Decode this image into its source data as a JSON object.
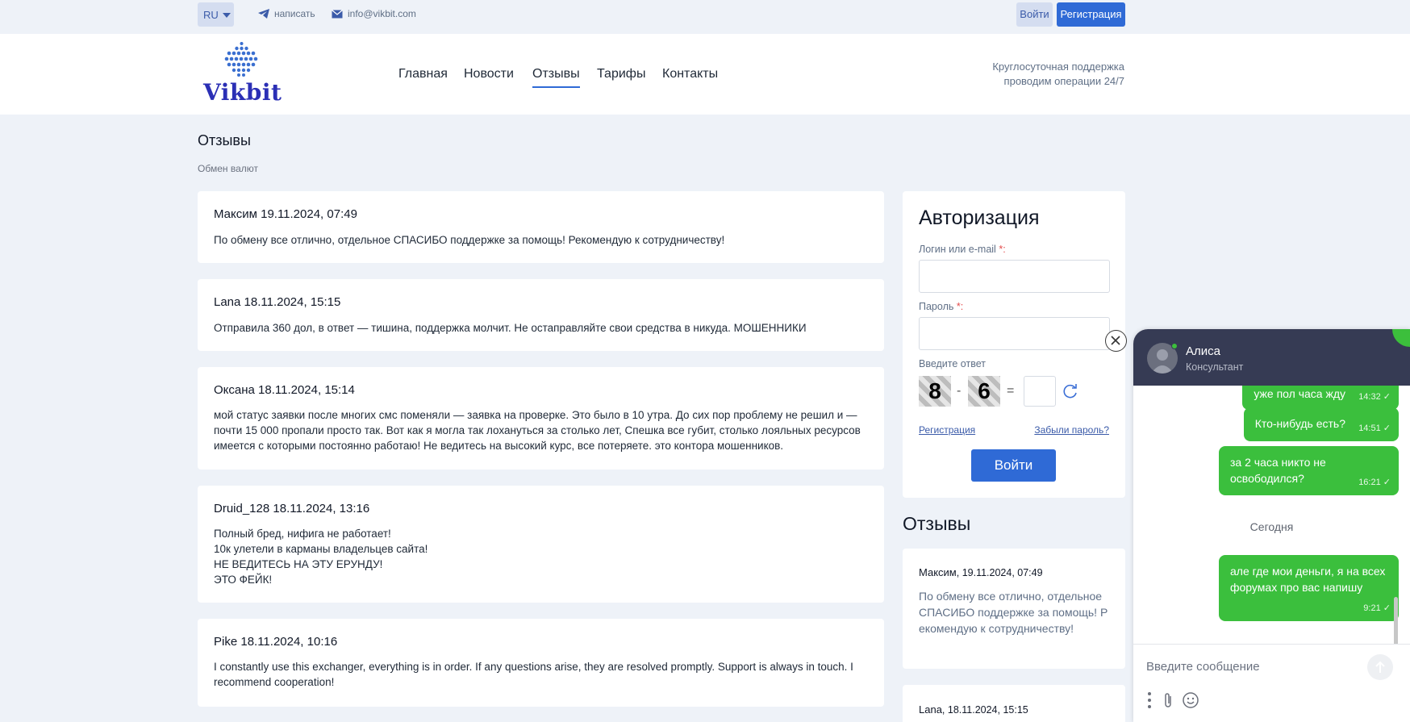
{
  "topbar": {
    "lang": "RU",
    "write_label": "написать",
    "email": "info@vikbit.com",
    "login_label": "Войти",
    "register_label": "Регистрация"
  },
  "header": {
    "logo_text": "Vikbit",
    "nav": [
      "Главная",
      "Новости",
      "Отзывы",
      "Тарифы",
      "Контакты"
    ],
    "active_nav": "Отзывы",
    "support_line1": "Круглосуточная поддержка",
    "support_line2": "проводим операции 24/7"
  },
  "page": {
    "title": "Отзывы",
    "breadcrumb": "Обмен валют"
  },
  "reviews": [
    {
      "header": "Максим 19.11.2024, 07:49",
      "text": "По обмену все отлично, отдельное СПАСИБО поддержке за помощь! Рекомендую к сотрудничеству!"
    },
    {
      "header": "Lana 18.11.2024, 15:15",
      "text": "Отправила 360 дол, в ответ — тишина, поддержка молчит. Не остаправляйте свои средства в никуда. МОШЕННИКИ"
    },
    {
      "header": "Оксана 18.11.2024, 15:14",
      "text": "мой статус заявки после многих смс поменяли — заявка на проверке. Это было в 10 утра. До сих пор проблему не решил и — почти 15 000 пропали просто так. Вот как я могла так лохануться за столько лет, Спешка все губит, столько лояльных ресурсов имеется с которыми постоянно работаю! Не ведитесь на высокий курс, все потеряете. это контора мошенников."
    },
    {
      "header": "Druid_128 18.11.2024, 13:16",
      "lines": [
        "Полный бред, нифига не работает!",
        "10к улетели в карманы владельцев сайта!",
        "НЕ ВЕДИТЕСЬ НА ЭТУ ЕРУНДУ!",
        "ЭТО ФЕЙК!"
      ]
    },
    {
      "header": "Pike 18.11.2024, 10:16",
      "text": "I constantly use this exchanger, everything is in order. If any questions arise, they are resolved promptly. Support is always in touch. I recommend cooperation!"
    }
  ],
  "auth": {
    "title": "Авторизация",
    "login_label": "Логин или e-mail",
    "password_label": "Пароль",
    "required_mark": "*",
    "colon": ":",
    "captcha_label": "Введите ответ",
    "captcha_a": "8",
    "captcha_op": "-",
    "captcha_b": "6",
    "captcha_eq": "=",
    "register_link": "Регистрация",
    "forgot_link": "Забыли пароль?",
    "submit": "Войти"
  },
  "sidebar": {
    "title": "Отзывы",
    "reviews": [
      {
        "name": "Максим",
        "date": ", 19.11.2024, 07:49",
        "text": "По обмену все отлично, отдельное СПАСИБО поддержке за помощь! Рекомендую к сотрудничеству!"
      },
      {
        "name": "Lana",
        "date": ", 18.11.2024, 15:15"
      }
    ]
  },
  "chat": {
    "agent_name": "Алиса",
    "agent_role": "Консультант",
    "messages": [
      {
        "text": "уже пол часа жду",
        "time": "14:32"
      },
      {
        "text": "Кто-нибудь есть?",
        "time": "14:51"
      },
      {
        "text": "за 2 часа никто не освободился?",
        "time": "16:21"
      },
      {
        "text": "але где мои деньги, я на всех форумах про вас напишу",
        "time": "9:21"
      }
    ],
    "day_separator": "Сегодня",
    "input_placeholder": "Введите сообщение",
    "colors": {
      "bubble": "#3bbf3d",
      "header": "#363b54"
    }
  }
}
